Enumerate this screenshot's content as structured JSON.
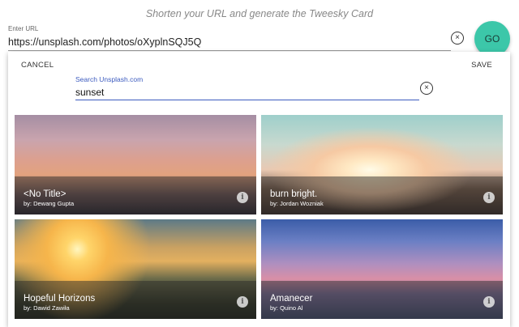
{
  "header": {
    "subtitle": "Shorten your URL and generate the Tweesky Card",
    "url_label": "Enter URL",
    "url_value": "https://unsplash.com/photos/oXyplnSQJ5Q",
    "clear_symbol": "×",
    "go_label": "GO"
  },
  "panel": {
    "cancel_label": "CANCEL",
    "save_label": "SAVE",
    "search_label": "Search Unsplash.com",
    "search_value": "sunset",
    "clear_symbol": "×"
  },
  "images": [
    {
      "title": "<No Title>",
      "author": "by: Dewang Gupta",
      "info": "i"
    },
    {
      "title": "burn bright.",
      "author": "by: Jordan Wozniak",
      "info": "i"
    },
    {
      "title": "Hopeful Horizons",
      "author": "by: Dawid Zawiła",
      "info": "i"
    },
    {
      "title": "Amanecer",
      "author": "by: Quino Al",
      "info": "i"
    }
  ],
  "colors": {
    "accent": "#3cc7a9",
    "search_focus": "#3c5bbf"
  }
}
